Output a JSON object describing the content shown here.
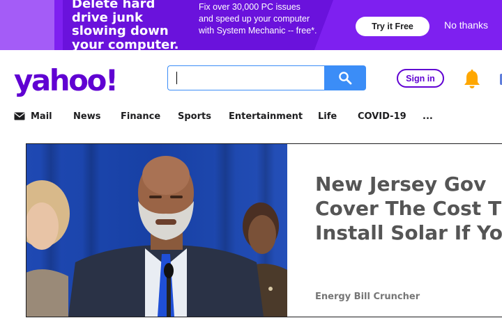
{
  "banner": {
    "headline": "Delete hard drive junk slowing down your computer.",
    "copy": "Fix over 30,000 PC issues and speed up your computer with System Mechanic -- free*.",
    "try_label": "Try it Free",
    "dismiss_label": "No thanks"
  },
  "header": {
    "logo_text": "yahoo!",
    "search_placeholder": "",
    "search_icon": "search-icon",
    "signin_label": "Sign in",
    "bell_icon": "bell-icon",
    "brand_color": "#6001d2",
    "accent_color": "#3b8df7",
    "bell_color": "#ffa700"
  },
  "nav": {
    "items": [
      {
        "label": "Mail",
        "icon": "mail-icon"
      },
      {
        "label": "News"
      },
      {
        "label": "Finance"
      },
      {
        "label": "Sports"
      },
      {
        "label": "Entertainment"
      },
      {
        "label": "Life"
      },
      {
        "label": "COVID-19"
      },
      {
        "label": "..."
      }
    ]
  },
  "story": {
    "headline_lines": [
      "New Jersey Gov",
      "Cover The Cost T",
      "Install Solar If Yo"
    ],
    "source": "Energy Bill Cruncher"
  }
}
